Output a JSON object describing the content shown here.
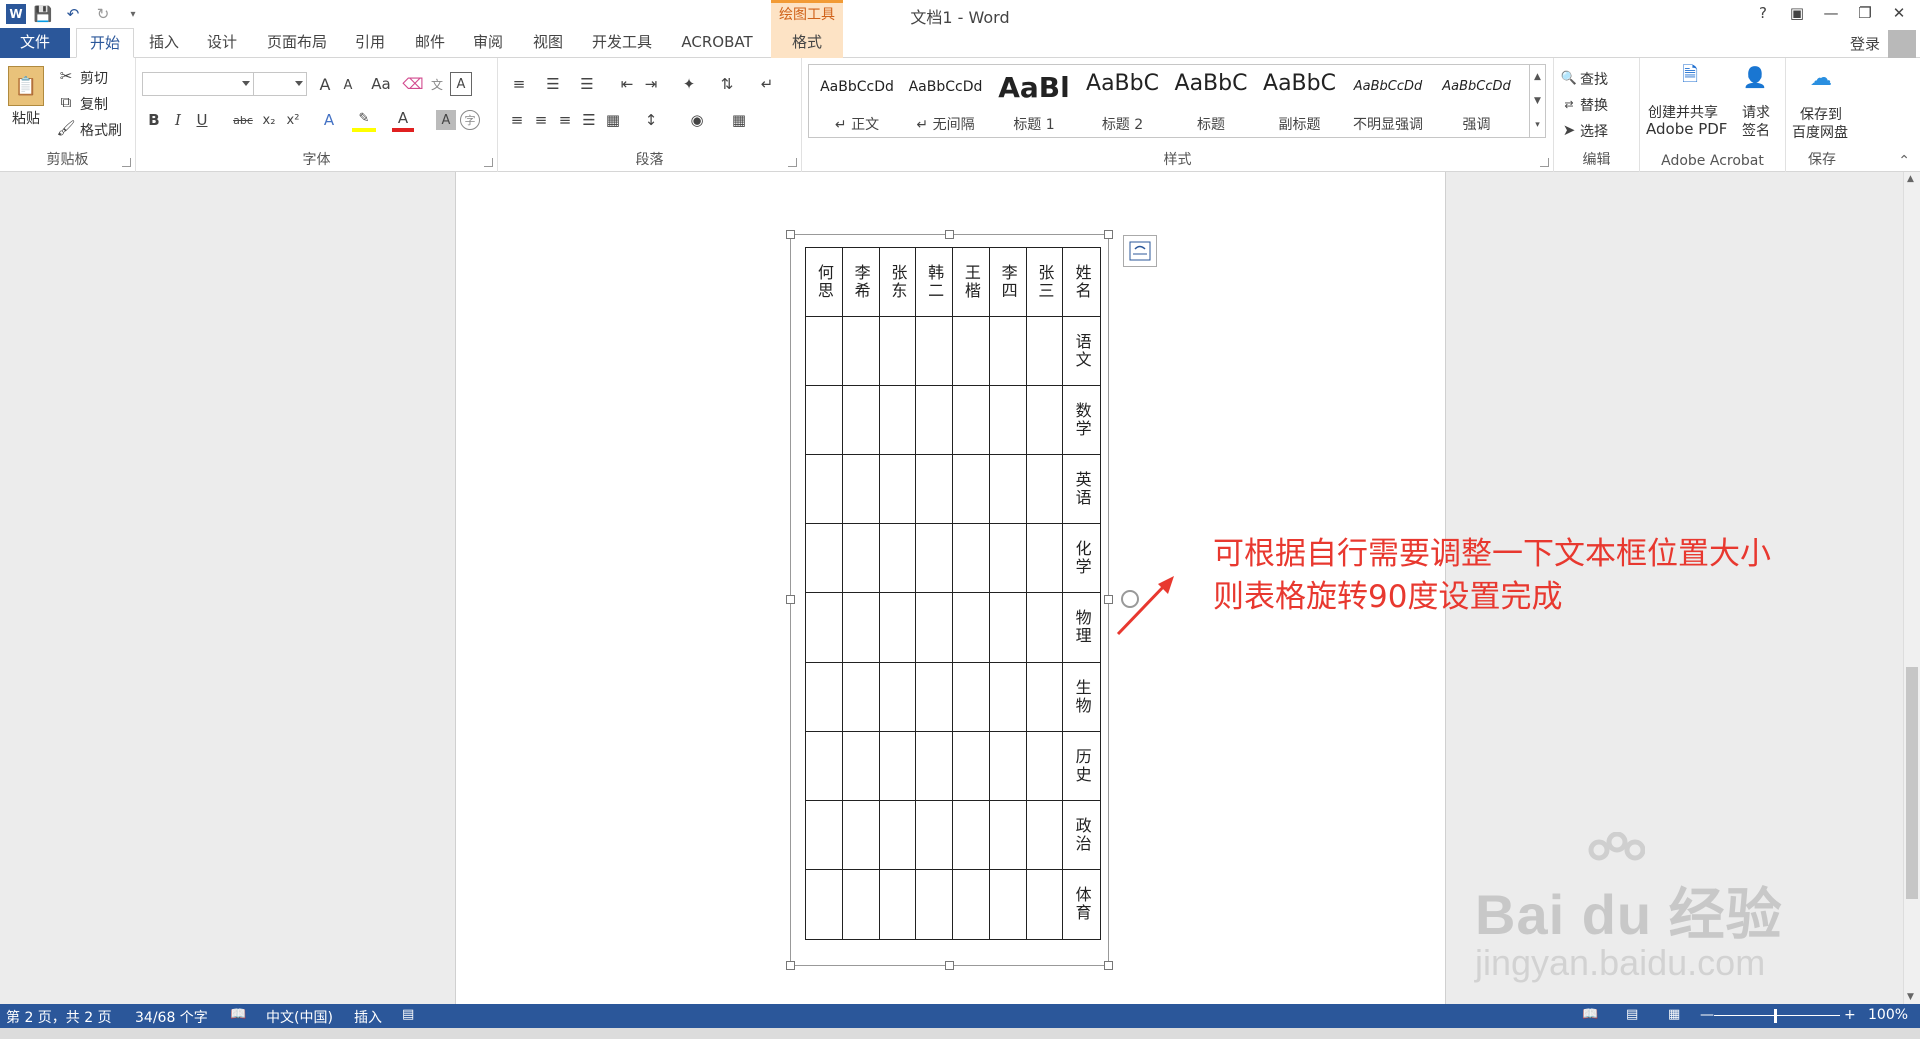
{
  "window": {
    "title": "文档1 - Word",
    "help": "?",
    "signin": "登录"
  },
  "context_tab": {
    "group": "绘图工具",
    "tab": "格式"
  },
  "tabs": [
    "文件",
    "开始",
    "插入",
    "设计",
    "页面布局",
    "引用",
    "邮件",
    "审阅",
    "视图",
    "开发工具",
    "ACROBAT"
  ],
  "clipboard": {
    "paste": "粘贴",
    "cut": "剪切",
    "copy": "复制",
    "format_painter": "格式刷",
    "label": "剪贴板"
  },
  "font": {
    "label": "字体",
    "grow": "A",
    "shrink": "A",
    "case": "Aa",
    "bold": "B",
    "italic": "I",
    "underline": "U",
    "strike": "abc",
    "sub": "x₂",
    "sup": "x²"
  },
  "paragraph": {
    "label": "段落"
  },
  "styles": {
    "label": "样式",
    "items": [
      {
        "sample": "AaBbCcDd",
        "name": "↵ 正文"
      },
      {
        "sample": "AaBbCcDd",
        "name": "↵ 无间隔"
      },
      {
        "sample": "AaBl",
        "name": "标题 1"
      },
      {
        "sample": "AaBbC",
        "name": "标题 2"
      },
      {
        "sample": "AaBbC",
        "name": "标题"
      },
      {
        "sample": "AaBbC",
        "name": "副标题"
      },
      {
        "sample": "AaBbCcDd",
        "name": "不明显强调"
      },
      {
        "sample": "AaBbCcDd",
        "name": "强调"
      }
    ]
  },
  "editing": {
    "label": "编辑",
    "find": "查找",
    "replace": "替换",
    "select": "选择"
  },
  "acrobat": {
    "label": "Adobe Acrobat",
    "create_line1": "创建并共享",
    "create_line2": "Adobe PDF",
    "sign_line1": "请求",
    "sign_line2": "签名"
  },
  "save": {
    "label": "保存",
    "btn_line1": "保存到",
    "btn_line2": "百度网盘"
  },
  "table": {
    "header_row": [
      "何思",
      "李希",
      "张东",
      "韩二",
      "王楷",
      "李四",
      "张三",
      "姓名"
    ],
    "subjects": [
      "语文",
      "数学",
      "英语",
      "化学",
      "物理",
      "生物",
      "历史",
      "政治",
      "体育"
    ]
  },
  "annotation": {
    "line1": "可根据自行需要调整一下文本框位置大小",
    "line2": "则表格旋转90度设置完成"
  },
  "watermark": {
    "logo": "Bai du 经验",
    "url": "jingyan.baidu.com"
  },
  "status": {
    "page": "第 2 页，共 2 页",
    "words": "34/68 个字",
    "language": "中文(中国)",
    "mode": "插入",
    "zoom": "100%"
  },
  "colors": {
    "accent": "#2b579a",
    "context_tab": "#f29b35",
    "annotation": "#e8382f"
  }
}
